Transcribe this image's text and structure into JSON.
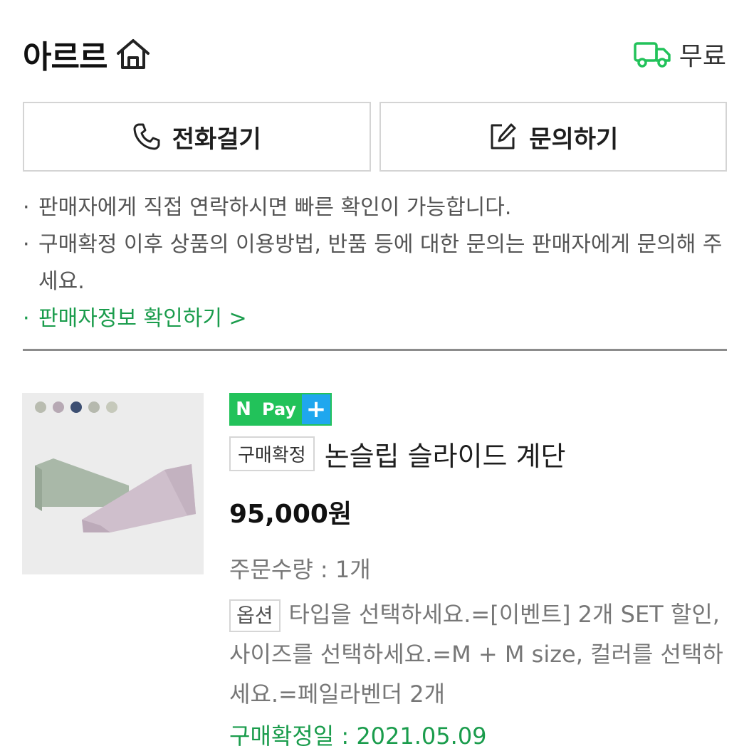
{
  "header": {
    "store_name": "아르르",
    "store_icon": "home-icon",
    "shipping_icon": "truck-icon",
    "shipping_label": "무료"
  },
  "actions": {
    "call_label": "전화걸기",
    "call_icon": "phone-icon",
    "inquiry_label": "문의하기",
    "inquiry_icon": "edit-icon"
  },
  "notices": {
    "bullet": "·",
    "line1": "판매자에게 직접 연락하시면 빠른 확인이 가능합니다.",
    "line2": "구매확정 이후 상품의 이용방법, 반품 등에 대한 문의는 판매자에게 문의해 주세요.",
    "seller_info_link": "판매자정보 확인하기 >"
  },
  "product": {
    "npay_n": "N",
    "npay_pay": "Pay",
    "npay_plus": "+",
    "status_badge": "구매확정",
    "title": "논슬립 슬라이드 계단",
    "price": "95,000원",
    "quantity": "주문수량 : 1개",
    "option_badge": "옵션",
    "option_text": "타입을 선택하세요.=[이벤트] 2개 SET 할인, 사이즈를 선택하세요.=M + M size, 컬러를 선택하세요.=페일라벤더 2개",
    "confirm_date": "구매확정일 : 2021.05.09"
  },
  "colors": {
    "accent_green": "#1a9c4c",
    "npay_green": "#22c25a",
    "npay_blue": "#1fa7ee"
  }
}
